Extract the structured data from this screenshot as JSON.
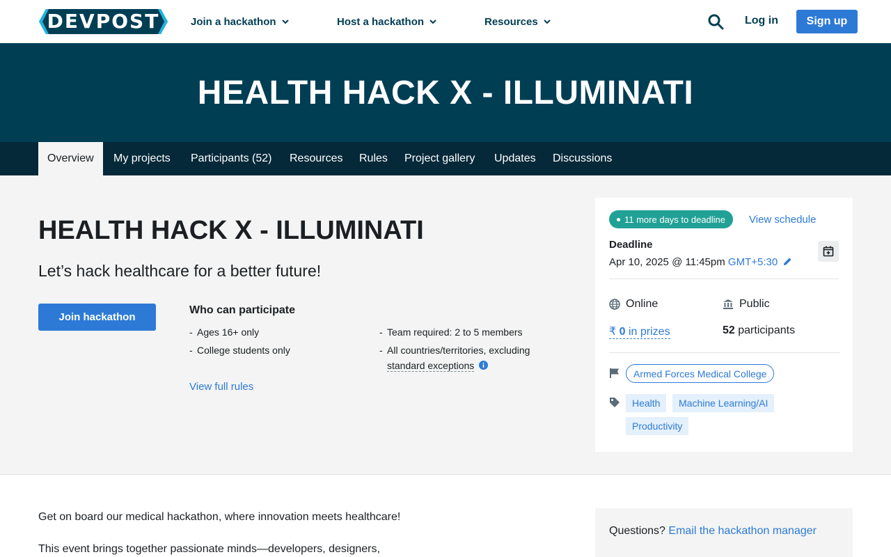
{
  "nav": {
    "logo_text": "DEVPOST",
    "join_label": "Join a hackathon",
    "host_label": "Host a hackathon",
    "resources_label": "Resources",
    "login_label": "Log in",
    "signup_label": "Sign up"
  },
  "hero": {
    "title": "HEALTH HACK X - ILLUMINATI"
  },
  "tabs": [
    {
      "label": "Overview"
    },
    {
      "label": "My projects"
    },
    {
      "label": "Participants (52)"
    },
    {
      "label": "Resources"
    },
    {
      "label": "Rules"
    },
    {
      "label": "Project gallery"
    },
    {
      "label": "Updates"
    },
    {
      "label": "Discussions"
    }
  ],
  "main": {
    "title": "HEALTH HACK X - ILLUMINATI",
    "tagline": "Let’s hack healthcare for a better future!",
    "join_button": "Join hackathon",
    "who_heading": "Who can participate",
    "rules": [
      "Ages 16+ only",
      "College students only",
      "Team required: 2 to 5 members",
      "All countries/territories, excluding",
      "standard exceptions"
    ],
    "view_rules": "View full rules"
  },
  "card": {
    "badge": "11 more days to deadline",
    "view_schedule": "View schedule",
    "deadline_label": "Deadline",
    "deadline_value": "Apr 10, 2025 @ 11:45pm",
    "timezone": "GMT+5:30",
    "location": "Online",
    "visibility": "Public",
    "prize_symbol": "₹",
    "prize_amount": "0",
    "prize_suffix": "in prizes",
    "participant_count": "52",
    "participant_suffix": "participants",
    "host": "Armed Forces Medical College",
    "themes": [
      "Health",
      "Machine Learning/AI",
      "Productivity"
    ]
  },
  "lower": {
    "para1": "Get on board our medical hackathon, where innovation meets healthcare!",
    "para2": "This event brings together passionate minds—developers, designers,",
    "questions_label": "Questions?",
    "questions_link": "Email the hackathon manager"
  },
  "colors": {
    "brand": "#003e54",
    "accent": "#2d7ad6",
    "teal": "#21a196"
  }
}
